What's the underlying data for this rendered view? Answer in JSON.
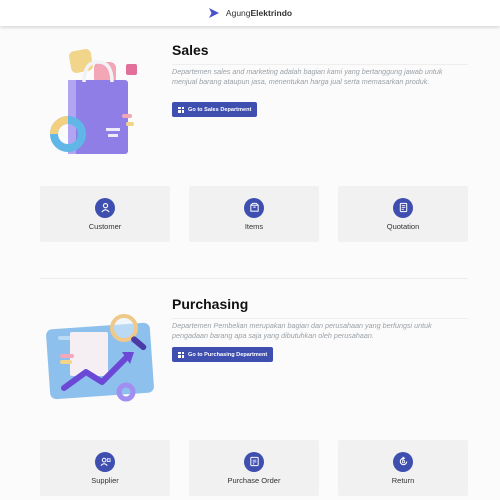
{
  "header": {
    "brand_light": "Agung",
    "brand_bold": "Elektrindo"
  },
  "sales": {
    "title": "Sales",
    "description": "Departemen sales and marketing adalah bagian kami yang bertanggung jawab untuk menjual barang ataupun jasa, menentukan harga jual serta memasarkan produk.",
    "button_label": "Go to Sales Department",
    "cards": [
      {
        "label": "Customer",
        "icon": "user-icon"
      },
      {
        "label": "Items",
        "icon": "box-icon"
      },
      {
        "label": "Quotation",
        "icon": "document-icon"
      }
    ]
  },
  "purchasing": {
    "title": "Purchasing",
    "description": "Departemen Pembelian merupakan bagian dan perusahaan yang berfungsi untuk pengadaan barang apa saja yang dibutuhkan oleh perusahaan.",
    "button_label": "Go to Purchasing Department",
    "cards": [
      {
        "label": "Supplier",
        "icon": "supplier-icon"
      },
      {
        "label": "Purchase Order",
        "icon": "order-icon"
      },
      {
        "label": "Return",
        "icon": "return-icon"
      }
    ]
  },
  "colors": {
    "accent": "#3f4fb0",
    "card_bg": "#f1f1f2"
  }
}
